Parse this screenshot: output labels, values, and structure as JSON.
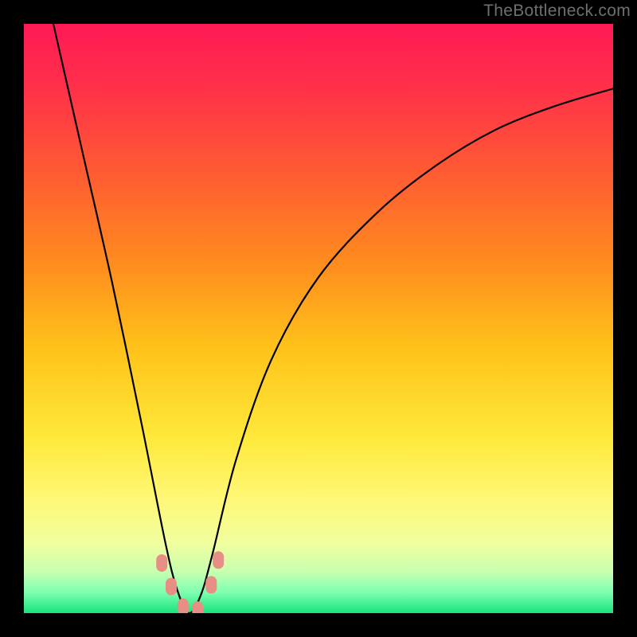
{
  "watermark": "TheBottleneck.com",
  "chart_data": {
    "type": "line",
    "title": "",
    "xlabel": "",
    "ylabel": "",
    "xlim": [
      0,
      1
    ],
    "ylim": [
      0,
      1
    ],
    "background": {
      "stops": [
        {
          "offset": 0.0,
          "color": "#ff1a55"
        },
        {
          "offset": 0.1,
          "color": "#ff2e4b"
        },
        {
          "offset": 0.25,
          "color": "#ff5a33"
        },
        {
          "offset": 0.4,
          "color": "#ff8a1f"
        },
        {
          "offset": 0.55,
          "color": "#ffc21a"
        },
        {
          "offset": 0.7,
          "color": "#ffe83a"
        },
        {
          "offset": 0.8,
          "color": "#fff773"
        },
        {
          "offset": 0.88,
          "color": "#f1ff9e"
        },
        {
          "offset": 0.93,
          "color": "#c8ffb0"
        },
        {
          "offset": 0.965,
          "color": "#7dffb0"
        },
        {
          "offset": 1.0,
          "color": "#18e47a"
        }
      ]
    },
    "series": [
      {
        "name": "bottleneck-curve",
        "note": "V-shaped curve. y is bottleneck fraction (0 good, 1 bad). Minimum near x≈0.28.",
        "x": [
          0.05,
          0.1,
          0.15,
          0.2,
          0.24,
          0.26,
          0.28,
          0.3,
          0.32,
          0.36,
          0.42,
          0.5,
          0.6,
          0.7,
          0.8,
          0.9,
          1.0
        ],
        "y": [
          1.0,
          0.78,
          0.56,
          0.32,
          0.12,
          0.04,
          0.0,
          0.03,
          0.1,
          0.26,
          0.43,
          0.57,
          0.68,
          0.76,
          0.82,
          0.86,
          0.89
        ]
      }
    ],
    "markers": {
      "name": "highlight-dots",
      "color": "#e88f85",
      "points": [
        {
          "x": 0.234,
          "y": 0.085
        },
        {
          "x": 0.25,
          "y": 0.045
        },
        {
          "x": 0.27,
          "y": 0.01
        },
        {
          "x": 0.295,
          "y": 0.005
        },
        {
          "x": 0.318,
          "y": 0.048
        },
        {
          "x": 0.33,
          "y": 0.09
        }
      ]
    }
  }
}
